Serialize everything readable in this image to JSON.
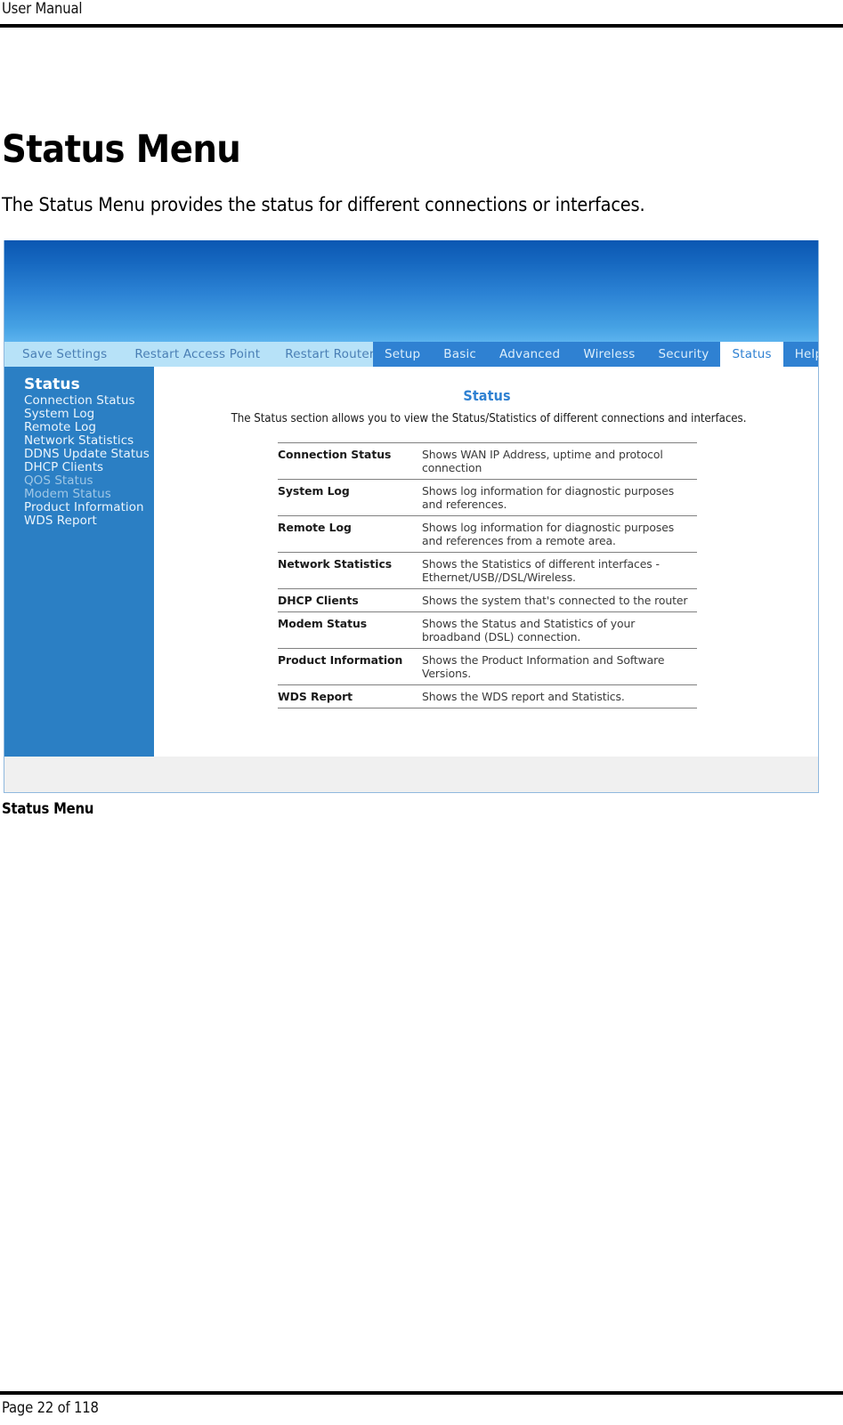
{
  "document": {
    "header_label": "User Manual",
    "title": "Status Menu",
    "intro": "The Status Menu provides the status for different connections or interfaces.",
    "figure_caption": "Status Menu",
    "footer": "Page 22  of 118"
  },
  "router_ui": {
    "action_links": [
      "Save Settings",
      "Restart Access Point",
      "Restart Router"
    ],
    "tabs": [
      {
        "label": "Setup",
        "active": false
      },
      {
        "label": "Basic",
        "active": false
      },
      {
        "label": "Advanced",
        "active": false
      },
      {
        "label": "Wireless",
        "active": false
      },
      {
        "label": "Security",
        "active": false
      },
      {
        "label": "Status",
        "active": true
      },
      {
        "label": "Help",
        "active": false
      }
    ],
    "sidebar": {
      "title": "Status",
      "items": [
        {
          "label": "Connection Status",
          "dim": false
        },
        {
          "label": "System Log",
          "dim": false
        },
        {
          "label": "Remote Log",
          "dim": false
        },
        {
          "label": "Network Statistics",
          "dim": false
        },
        {
          "label": "DDNS Update Status",
          "dim": false
        },
        {
          "label": "DHCP Clients",
          "dim": false
        },
        {
          "label": "QOS Status",
          "dim": true
        },
        {
          "label": "Modem Status",
          "dim": true
        },
        {
          "label": "Product Information",
          "dim": false
        },
        {
          "label": "WDS Report",
          "dim": false
        }
      ]
    },
    "content": {
      "title": "Status",
      "subtitle": "The Status section allows you to view the Status/Statistics of different connections and interfaces.",
      "rows": [
        {
          "name": "Connection Status",
          "description": "Shows WAN IP Address, uptime and protocol connection"
        },
        {
          "name": "System Log",
          "description": "Shows log information for diagnostic purposes and references."
        },
        {
          "name": "Remote Log",
          "description": "Shows log information for diagnostic purposes and references from a remote area."
        },
        {
          "name": "Network Statistics",
          "description": "Shows the Statistics of different interfaces - Ethernet/USB//DSL/Wireless."
        },
        {
          "name": "DHCP Clients",
          "description": "Shows the system that's connected to the router"
        },
        {
          "name": "Modem Status",
          "description": "Shows the Status and Statistics of your broadband (DSL) connection."
        },
        {
          "name": "Product Information",
          "description": "Shows the Product Information and Software Versions."
        },
        {
          "name": "WDS Report",
          "description": "Shows the WDS report and Statistics."
        }
      ]
    },
    "colors": {
      "banner_top": "#0b57b2",
      "banner_bottom": "#5cb3ee",
      "sidebar_bg": "#2b7fc4",
      "tabbar_bg": "#2f81d2",
      "actionbar_bg": "#b7e2f8",
      "accent_text": "#2f81d2",
      "panel_border": "#8fb8de",
      "panel_footer_bg": "#f0f0f0"
    }
  }
}
